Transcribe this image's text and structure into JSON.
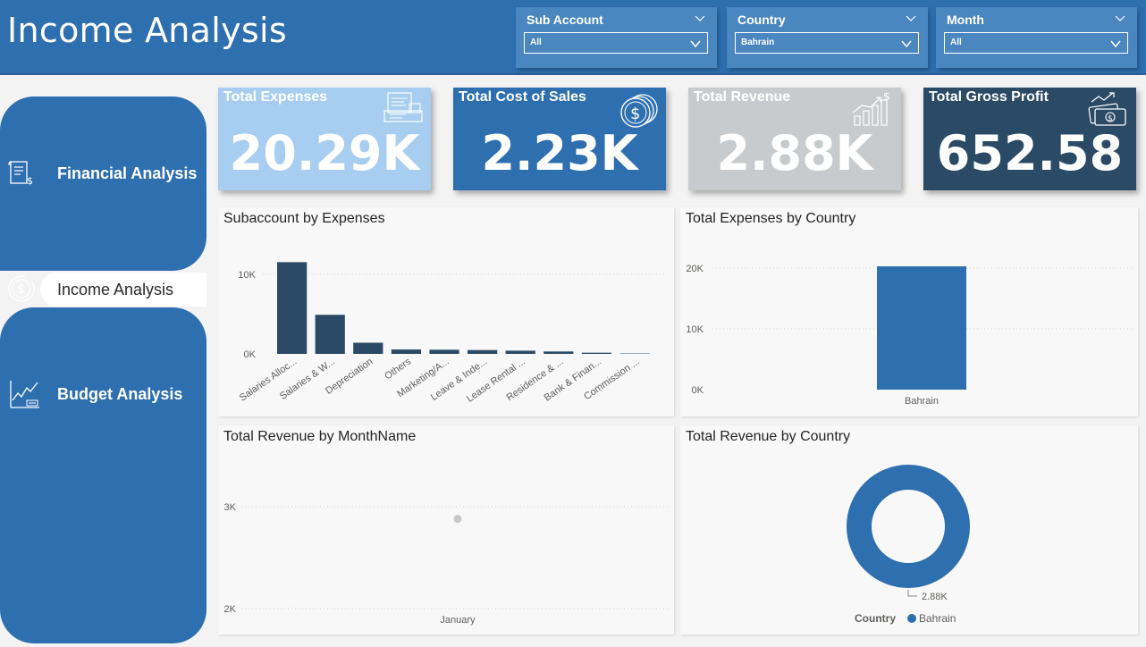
{
  "header": {
    "title": "Income Analysis"
  },
  "slicers": [
    {
      "title": "Sub Account",
      "value": "All"
    },
    {
      "title": "Country",
      "value": "Bahrain"
    },
    {
      "title": "Month",
      "value": "All"
    }
  ],
  "nav": {
    "items": [
      {
        "label": "Financial Analysis",
        "icon": "document-dollar-icon"
      },
      {
        "label": "Income Analysis",
        "icon": "dollar-cycle-icon",
        "active": true
      },
      {
        "label": "Budget Analysis",
        "icon": "growth-chart-icon"
      }
    ]
  },
  "kpis": [
    {
      "label": "Total Expenses",
      "value": "20.29K",
      "color": "#a7cdf0",
      "icon": "invoice-icon"
    },
    {
      "label": "Total Cost of Sales",
      "value": "2.23K",
      "color": "#2e6fb0",
      "icon": "coins-icon"
    },
    {
      "label": "Total Revenue",
      "value": "2.88K",
      "color": "#c8cbcd",
      "icon": "revenue-growth-icon"
    },
    {
      "label": "Total Gross Profit",
      "value": "652.58",
      "color": "#2a4a66",
      "icon": "money-growth-icon"
    }
  ],
  "charts": {
    "subaccount": {
      "title": "Subaccount by Expenses"
    },
    "expenses_country": {
      "title": "Total Expenses by Country"
    },
    "revenue_month": {
      "title": "Total Revenue by MonthName"
    },
    "revenue_country": {
      "title": "Total Revenue by Country"
    }
  },
  "chart_data": [
    {
      "type": "bar",
      "title": "Subaccount by Expenses",
      "categories": [
        "Salaries Alloc...",
        "Salaries & W...",
        "Depreciation",
        "Others",
        "Marketing/A...",
        "Leave & Inde...",
        "Lease Rental ...",
        "Residence & ...",
        "Bank & Finan...",
        "Commission ..."
      ],
      "values": [
        11500,
        4900,
        1400,
        550,
        520,
        480,
        400,
        300,
        150,
        50
      ],
      "yticks": [
        {
          "v": 0,
          "label": "0K"
        },
        {
          "v": 10000,
          "label": "10K"
        }
      ],
      "ylim": [
        0,
        13000
      ],
      "color": "#2a4a66"
    },
    {
      "type": "bar",
      "title": "Total Expenses by Country",
      "categories": [
        "Bahrain"
      ],
      "values": [
        20290
      ],
      "yticks": [
        {
          "v": 0,
          "label": "0K"
        },
        {
          "v": 10000,
          "label": "10K"
        },
        {
          "v": 20000,
          "label": "20K"
        }
      ],
      "ylim": [
        0,
        20000
      ],
      "color": "#2e6fb0"
    },
    {
      "type": "scatter",
      "title": "Total Revenue by MonthName",
      "categories": [
        "January"
      ],
      "values": [
        2880
      ],
      "yticks": [
        {
          "v": 2000,
          "label": "2K"
        },
        {
          "v": 3000,
          "label": "3K"
        }
      ],
      "ylim": [
        2000,
        3000
      ],
      "color": "#c8c8c8"
    },
    {
      "type": "pie",
      "title": "Total Revenue by Country",
      "legend_title": "Country",
      "slices": [
        {
          "label": "Bahrain",
          "value": 2880,
          "value_label": "2.88K"
        }
      ],
      "color": "#2e6fb0"
    }
  ]
}
